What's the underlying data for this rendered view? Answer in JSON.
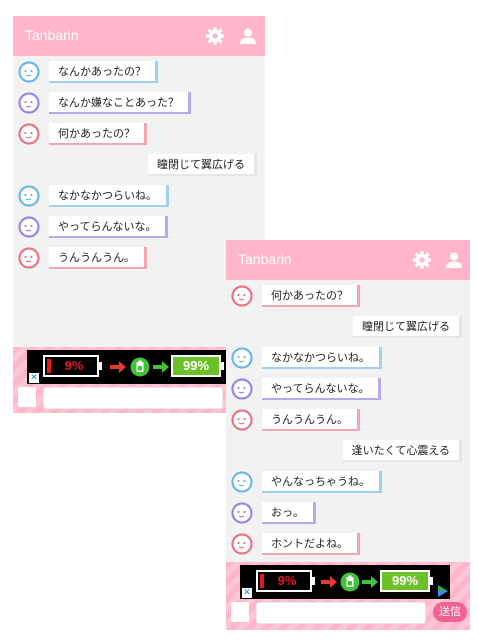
{
  "colors": {
    "header": "#ffb6c9",
    "background": "#f2f2f2",
    "blue_character": "#6bb7ea",
    "purple_character": "#9a86e6",
    "pink_character": "#ea7484",
    "send_button": "#f06292"
  },
  "screen1": {
    "app_title": "Tanbarin",
    "header_icons": [
      "gear-icon",
      "user-icon"
    ],
    "messages": [
      {
        "side": "left",
        "character": "blue",
        "text": "なんかあったの？"
      },
      {
        "side": "left",
        "character": "purple",
        "text": "なんか嫌なことあった？"
      },
      {
        "side": "left",
        "character": "pink",
        "text": "何かあったの？"
      },
      {
        "side": "right",
        "character": "user",
        "text": "瞳閉じて翼広げる"
      },
      {
        "side": "left",
        "character": "blue",
        "text": "なかなかつらいね。"
      },
      {
        "side": "left",
        "character": "purple",
        "text": "やってらんないな。"
      },
      {
        "side": "left",
        "character": "pink",
        "text": "うんうんうん。"
      }
    ],
    "ad": {
      "low_battery": "9%",
      "full_battery": "99%",
      "close": "✕"
    }
  },
  "screen2": {
    "app_title": "Tanbarin",
    "header_icons": [
      "gear-icon",
      "user-icon"
    ],
    "messages": [
      {
        "side": "left",
        "character": "pink",
        "text": "何かあったの？"
      },
      {
        "side": "right",
        "character": "user",
        "text": "瞳閉じて翼広げる"
      },
      {
        "side": "left",
        "character": "blue",
        "text": "なかなかつらいね。"
      },
      {
        "side": "left",
        "character": "purple",
        "text": "やってらんないな。"
      },
      {
        "side": "left",
        "character": "pink",
        "text": "うんうんうん。"
      },
      {
        "side": "right",
        "character": "user",
        "text": "逢いたくて心震える"
      },
      {
        "side": "left",
        "character": "blue",
        "text": "やんなっちゃうね。"
      },
      {
        "side": "left",
        "character": "purple",
        "text": "おっ。"
      },
      {
        "side": "left",
        "character": "pink",
        "text": "ホントだよね。"
      }
    ],
    "ad": {
      "low_battery": "9%",
      "full_battery": "99%",
      "close": "✕"
    },
    "send_label": "送信"
  }
}
